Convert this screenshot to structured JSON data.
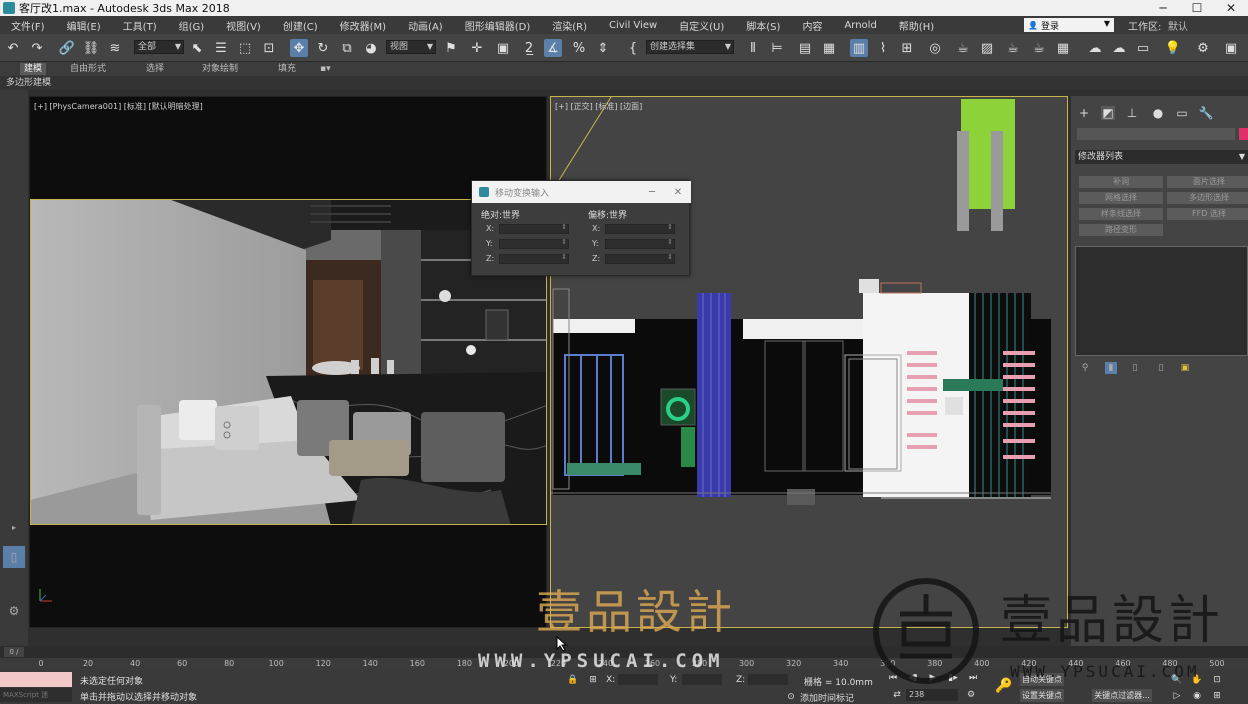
{
  "window": {
    "title": "客厅改1.max - Autodesk 3ds Max 2018",
    "controls": [
      "─",
      "☐",
      "✕"
    ]
  },
  "menu": {
    "items": [
      "文件(F)",
      "编辑(E)",
      "工具(T)",
      "组(G)",
      "视图(V)",
      "创建(C)",
      "修改器(M)",
      "动画(A)",
      "图形编辑器(D)",
      "渲染(R)",
      "Civil View",
      "自定义(U)",
      "脚本(S)",
      "内容",
      "Arnold",
      "帮助(H)"
    ],
    "login": "登录",
    "workspace_label": "工作区:",
    "workspace_value": "默认"
  },
  "toolbar": {
    "selection_filter": "全部",
    "reference_coord": "视图",
    "named_selection": "创建选择集"
  },
  "ribbon": {
    "tabs": [
      "建模",
      "自由形式",
      "选择",
      "对象绘制",
      "填充"
    ],
    "subpanel": "多边形建模"
  },
  "viewport_left": {
    "label": "[+] [PhysCamera001] [标准] [默认明暗处理]"
  },
  "viewport_right": {
    "label": "[+] [正交] [标准] [边面]"
  },
  "dialog": {
    "title": "移动变换输入",
    "absolute_header": "绝对:世界",
    "offset_header": "偏移:世界",
    "axes": [
      "X:",
      "Y:",
      "Z:"
    ]
  },
  "command_panel": {
    "modifier_list": "修改器列表",
    "buttons": [
      "补洞",
      "面片选择",
      "网格选择",
      "多边形选择",
      "样条线选择",
      "FFD 选择",
      "路径变形"
    ]
  },
  "timeline": {
    "slider": "0 / 100",
    "ticks": [
      "0",
      "20",
      "40",
      "60",
      "80",
      "100",
      "120",
      "140",
      "160",
      "180",
      "200",
      "220",
      "240",
      "260",
      "280",
      "300",
      "320",
      "340",
      "360",
      "380",
      "400",
      "420",
      "440",
      "460",
      "480",
      "500"
    ]
  },
  "status": {
    "maxscript": "MAXScript 迷",
    "line1": "未选定任何对象",
    "line2": "单击并拖动以选择并移动对象",
    "x_label": "X:",
    "y_label": "Y:",
    "z_label": "Z:",
    "grid": "栅格 = 10.0mm",
    "add_time_tag": "添加时间标记",
    "frame_value": "238",
    "auto_key": "自动关键点",
    "set_key": "设置关键点",
    "key_filters": "关键点过滤器..."
  },
  "watermark": {
    "brand": "壹品設計",
    "url": "WWW.YPSUCAI.COM",
    "url_right": "WWW.YPSUCAI.COM"
  },
  "colors": {
    "viewport_active_border": "#c8b54a",
    "accent_blue": "#5a7fa8",
    "swatch": "#e0306a"
  }
}
